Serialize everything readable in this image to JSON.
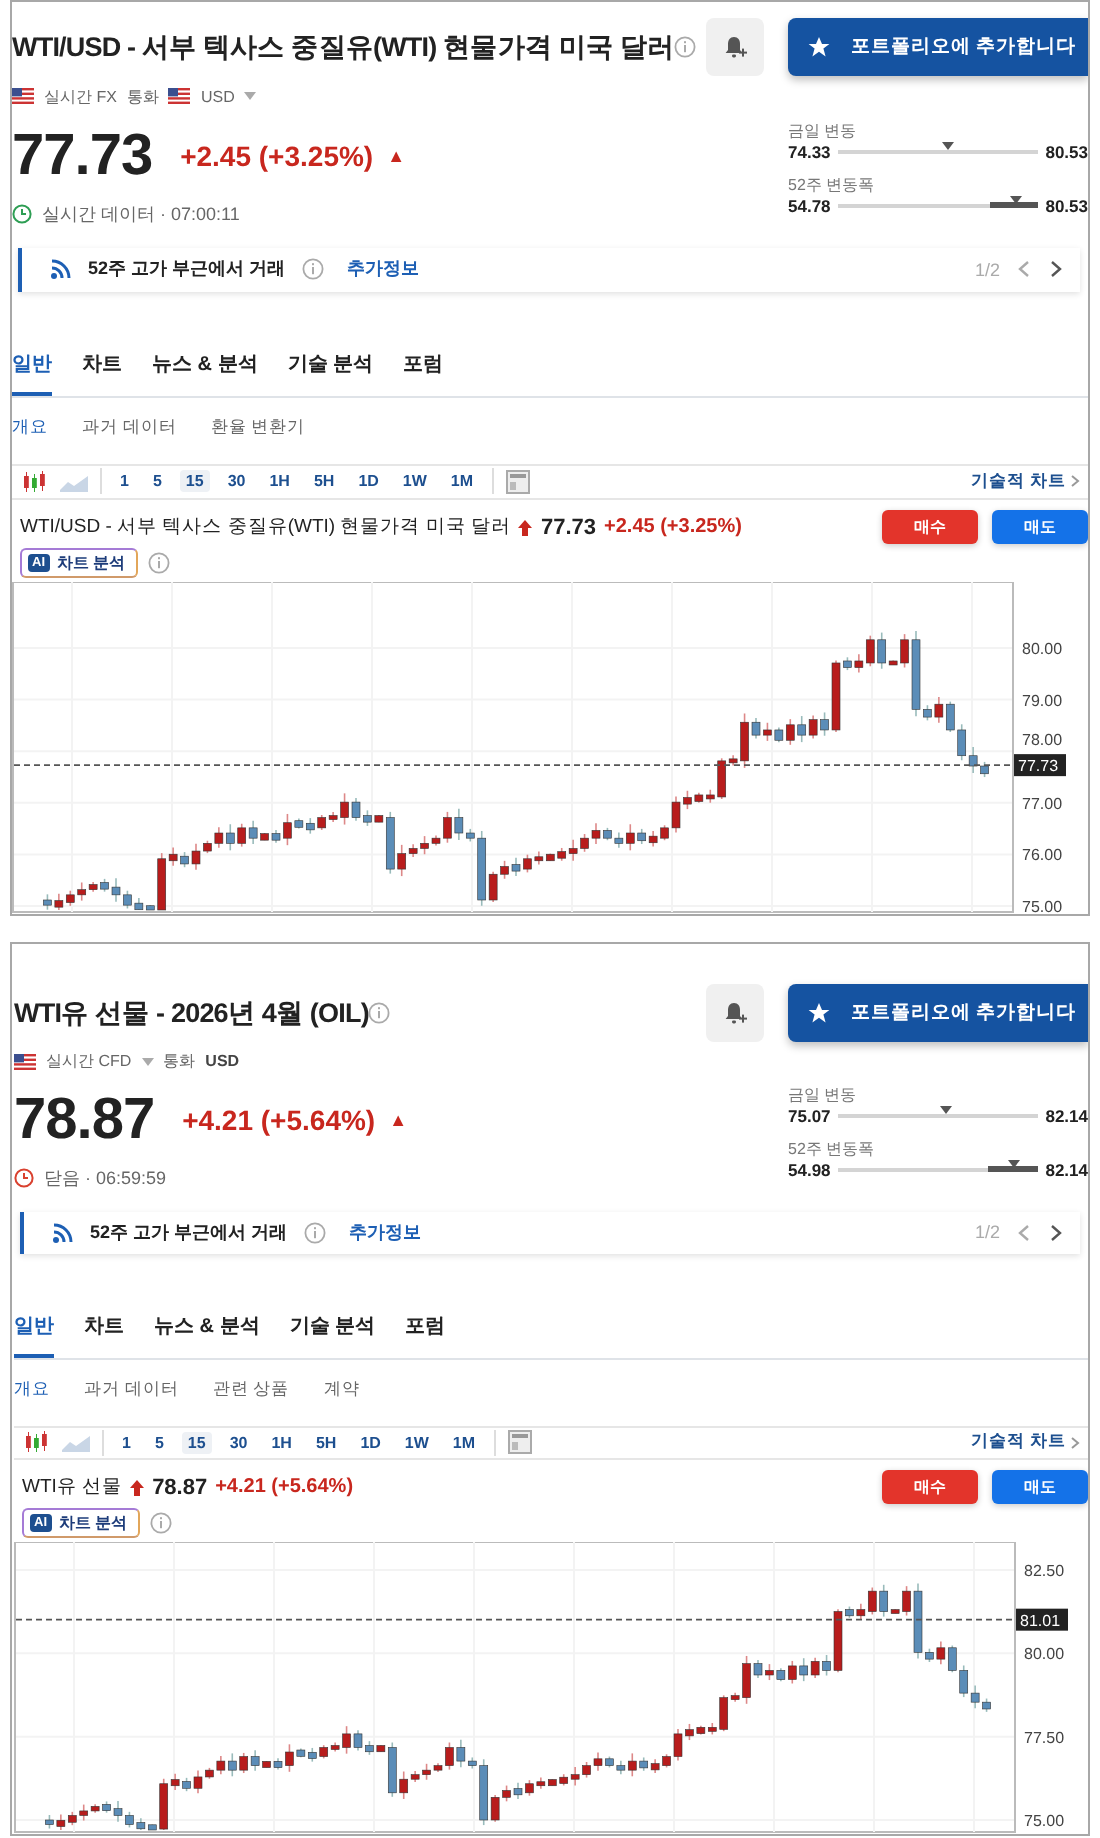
{
  "panels": [
    {
      "title": "WTI/USD - 서부 텍사스 중질유(WTI) 현물가격 미국 달러",
      "portfolio_button": "포트폴리오에 추가합니다",
      "meta": [
        {
          "kind": "flag"
        },
        {
          "kind": "label",
          "text": "실시간 FX"
        },
        {
          "kind": "label",
          "text": "통화"
        },
        {
          "kind": "flag"
        },
        {
          "kind": "label",
          "text": "USD"
        },
        {
          "kind": "caret"
        }
      ],
      "price": "77.73",
      "change": "+2.45 (+3.25%)",
      "change_arrow": "▲",
      "status": {
        "kind": "live",
        "text": "실시간 데이터 · 07:00:11"
      },
      "ranges": [
        {
          "label": "금일 변동",
          "low": "74.33",
          "high": "80.53",
          "level": 0.55
        },
        {
          "label": "52주 변동폭",
          "low": "54.78",
          "high": "80.53",
          "level": 0.89
        }
      ],
      "notice": {
        "text": "52주 고가 부근에서 거래",
        "link": "추가정보",
        "pager": "1/2"
      },
      "tabs": [
        {
          "label": "일반",
          "selected": true
        },
        {
          "label": "차트",
          "selected": false
        },
        {
          "label": "뉴스 & 분석",
          "selected": false
        },
        {
          "label": "기술 분석",
          "selected": false
        },
        {
          "label": "포럼",
          "selected": false
        }
      ],
      "subtabs": [
        {
          "label": "개요",
          "selected": true
        },
        {
          "label": "과거 데이터",
          "selected": false
        },
        {
          "label": "환율 변환기",
          "selected": false
        }
      ],
      "timeframes": [
        {
          "label": "1",
          "selected": false
        },
        {
          "label": "5",
          "selected": false
        },
        {
          "label": "15",
          "selected": true
        },
        {
          "label": "30",
          "selected": false
        },
        {
          "label": "1H",
          "selected": false
        },
        {
          "label": "5H",
          "selected": false
        },
        {
          "label": "1D",
          "selected": false
        },
        {
          "label": "1W",
          "selected": false
        },
        {
          "label": "1M",
          "selected": false
        }
      ],
      "technical_link": "기술적 차트",
      "chart_header": {
        "name": "WTI/USD - 서부 텍사스 중질유(WTI) 현물가격 미국 달러",
        "price": "77.73",
        "change": "+2.45 (+3.25%)"
      },
      "buy_button": "매수",
      "sell_button": "매도",
      "ai_badge": "AI",
      "ai_button": "차트 분석",
      "chart": {
        "y_labels": [
          "80.00",
          "79.00",
          "78.00",
          "77.00",
          "76.00",
          "75.00"
        ],
        "price_tag": "77.73"
      }
    },
    {
      "title": "WTI유 선물 - 2026년 4월 (OIL)",
      "portfolio_button": "포트폴리오에 추가합니다",
      "meta": [
        {
          "kind": "flag"
        },
        {
          "kind": "label",
          "text": "실시간 CFD"
        },
        {
          "kind": "caret"
        },
        {
          "kind": "label",
          "text": "통화"
        },
        {
          "kind": "value",
          "text": "USD"
        }
      ],
      "price": "78.87",
      "change": "+4.21 (+5.64%)",
      "change_arrow": "▲",
      "status": {
        "kind": "closed",
        "text": "닫음 · 06:59:59"
      },
      "ranges": [
        {
          "label": "금일 변동",
          "low": "75.07",
          "high": "82.14",
          "level": 0.54
        },
        {
          "label": "52주 변동폭",
          "low": "54.98",
          "high": "82.14",
          "level": 0.88
        }
      ],
      "notice": {
        "text": "52주 고가 부근에서 거래",
        "link": "추가정보",
        "pager": "1/2"
      },
      "tabs": [
        {
          "label": "일반",
          "selected": true
        },
        {
          "label": "차트",
          "selected": false
        },
        {
          "label": "뉴스 & 분석",
          "selected": false
        },
        {
          "label": "기술 분석",
          "selected": false
        },
        {
          "label": "포럼",
          "selected": false
        }
      ],
      "subtabs": [
        {
          "label": "개요",
          "selected": true
        },
        {
          "label": "과거 데이터",
          "selected": false
        },
        {
          "label": "관련 상품",
          "selected": false
        },
        {
          "label": "계약",
          "selected": false
        }
      ],
      "timeframes": [
        {
          "label": "1",
          "selected": false
        },
        {
          "label": "5",
          "selected": false
        },
        {
          "label": "15",
          "selected": true
        },
        {
          "label": "30",
          "selected": false
        },
        {
          "label": "1H",
          "selected": false
        },
        {
          "label": "5H",
          "selected": false
        },
        {
          "label": "1D",
          "selected": false
        },
        {
          "label": "1W",
          "selected": false
        },
        {
          "label": "1M",
          "selected": false
        }
      ],
      "technical_link": "기술적 차트",
      "chart_header": {
        "name": "WTI유 선물",
        "price": "78.87",
        "change": "+4.21 (+5.64%)"
      },
      "buy_button": "매수",
      "sell_button": "매도",
      "ai_badge": "AI",
      "ai_button": "차트 분석",
      "chart": {
        "y_labels": [
          "82.50",
          "80.00",
          "77.50",
          "75.00"
        ],
        "price_tag": "81.01"
      }
    }
  ]
}
